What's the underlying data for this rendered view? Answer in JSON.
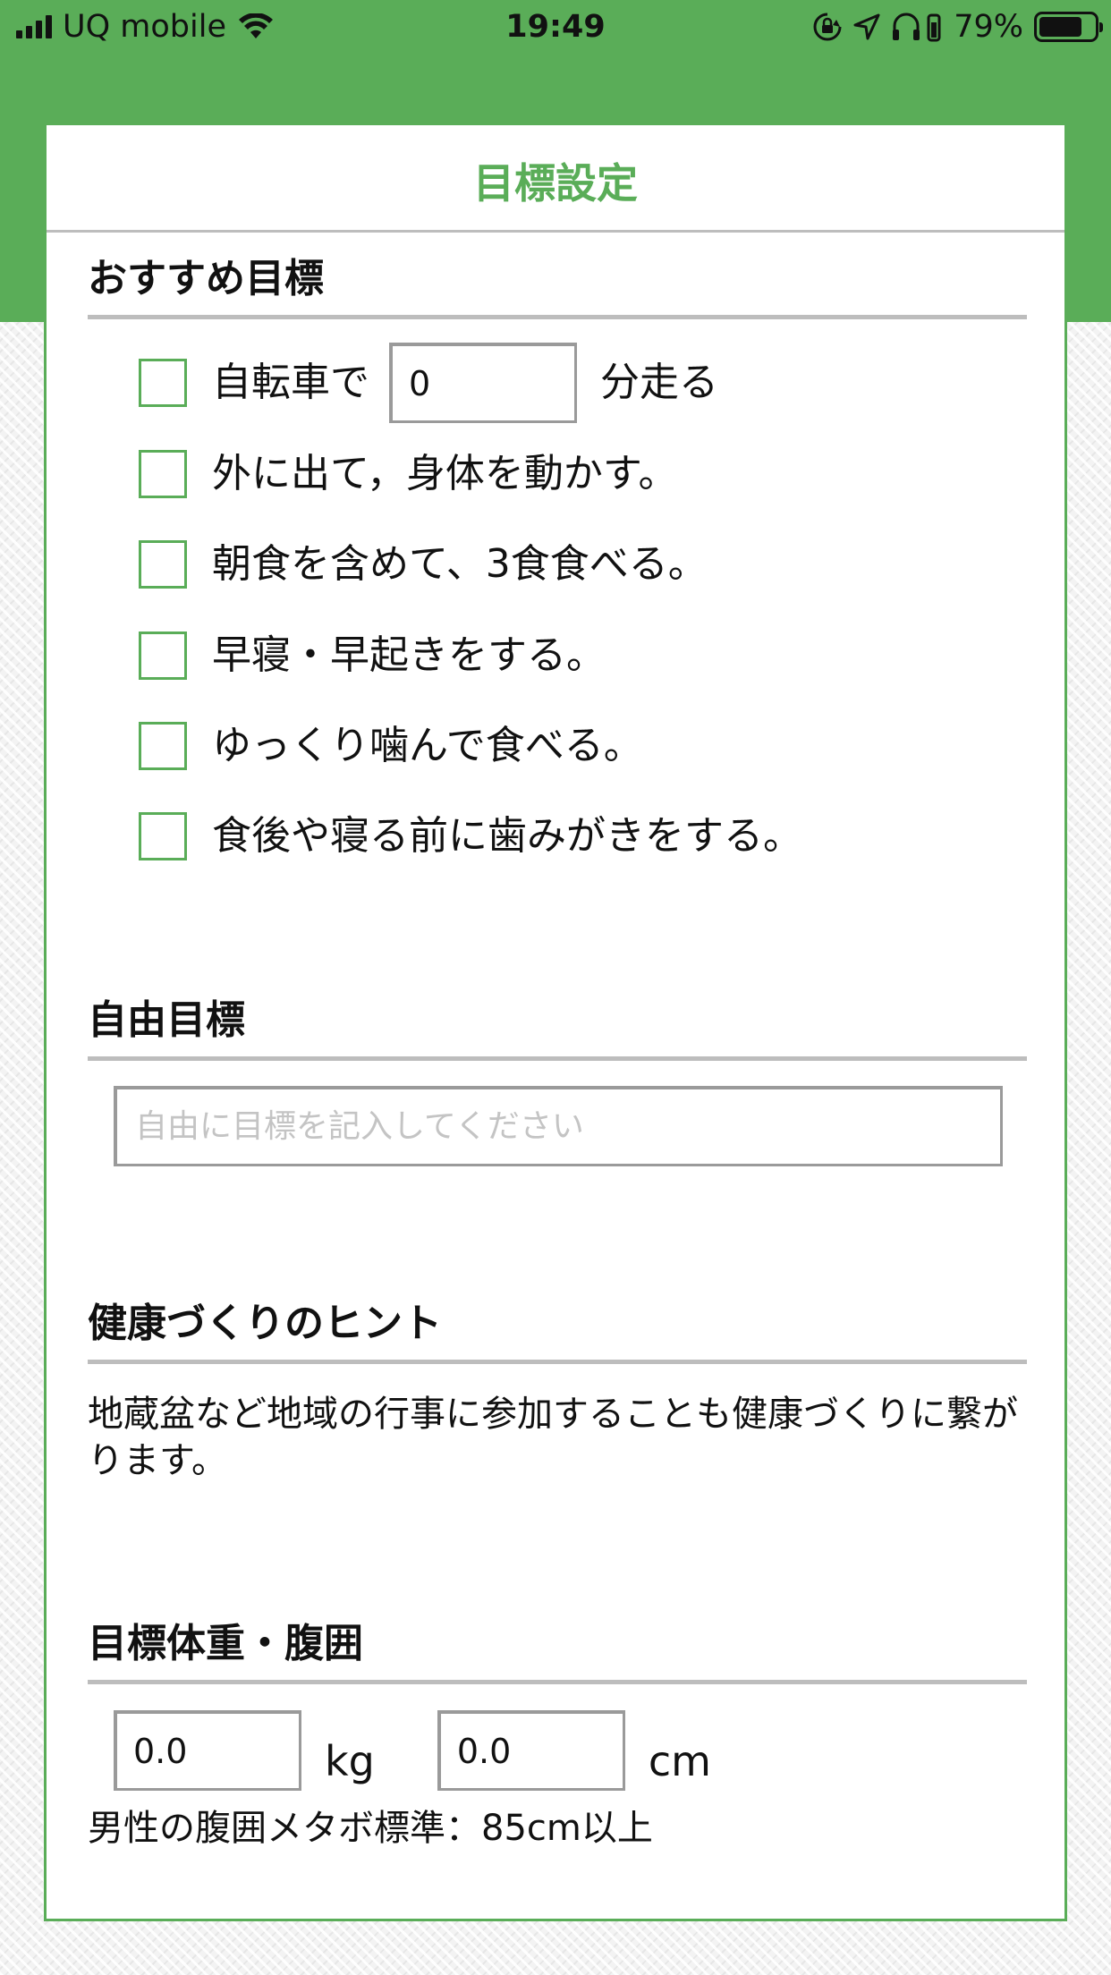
{
  "status_bar": {
    "carrier": "UQ mobile",
    "time": "19:49",
    "battery_percent": "79%",
    "battery_level": 0.79
  },
  "header": {
    "title": "目標設定"
  },
  "recommended": {
    "title": "おすすめ目標",
    "bicycle": {
      "prefix": "自転車で",
      "minutes_value": "0",
      "suffix": "分走る",
      "checked": false
    },
    "items": [
      {
        "label": "外に出て，身体を動かす。",
        "checked": false
      },
      {
        "label": "朝食を含めて、3食食べる。",
        "checked": false
      },
      {
        "label": "早寝・早起きをする。",
        "checked": false
      },
      {
        "label": "ゆっくり噛んで食べる。",
        "checked": false
      },
      {
        "label": "食後や寝る前に歯みがきをする。",
        "checked": false
      }
    ]
  },
  "free_goal": {
    "title": "自由目標",
    "placeholder": "自由に目標を記入してください",
    "value": ""
  },
  "hint": {
    "title": "健康づくりのヒント",
    "text": "地蔵盆など地域の行事に参加することも健康づくりに繋がります。"
  },
  "target_body": {
    "title": "目標体重・腹囲",
    "weight_value": "0.0",
    "weight_unit": "kg",
    "waist_value": "0.0",
    "waist_unit": "cm",
    "note": "男性の腹囲メタボ標準：85cm以上"
  },
  "colors": {
    "accent": "#5aad58",
    "divider": "#bdbdbd"
  }
}
